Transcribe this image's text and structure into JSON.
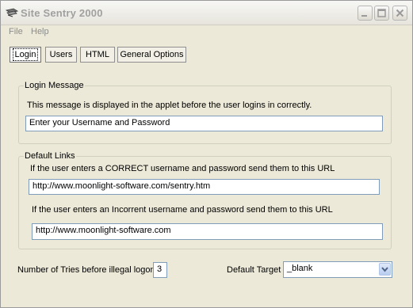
{
  "window": {
    "title": "Site Sentry 2000"
  },
  "menu": [
    "File",
    "Help"
  ],
  "tabs": [
    "Login",
    "Users",
    "HTML",
    "General Options"
  ],
  "login_message": {
    "group_label": "Login Message",
    "description": "This message is displayed in the applet before the user logins in correctly.",
    "value": "Enter your Username and Password"
  },
  "default_links": {
    "group_label": "Default Links",
    "correct_label": "If the user enters a CORRECT username and password send them to this URL",
    "correct_url": "http://www.moonlight-software.com/sentry.htm",
    "incorrect_label": "If the user enters an Incorrent username and password send them to this URL",
    "incorrect_url": "http://www.moonlight-software.com"
  },
  "tries": {
    "label": "Number of Tries before illegal logon.",
    "value": "3"
  },
  "target": {
    "label": "Default Target",
    "value": "_blank"
  },
  "icons": {
    "app": "app-icon",
    "minimize": "minimize-icon",
    "maximize": "maximize-icon",
    "close": "close-icon",
    "dropdown": "chevron-down-icon"
  }
}
